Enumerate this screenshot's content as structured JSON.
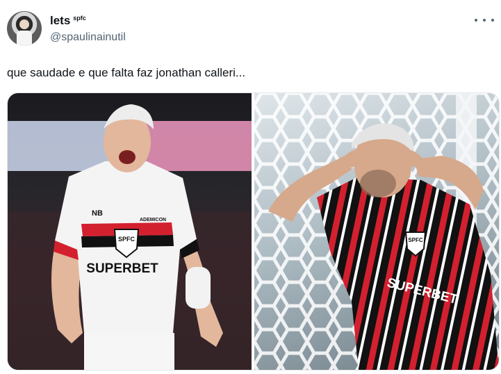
{
  "author": {
    "display_name": "lets",
    "name_badge": "spfc",
    "handle": "@spaulinainutil",
    "avatar_icon": "avatar-photo"
  },
  "more_icon": "more-horizontal-icon",
  "tweet_text": "que saudade e que falta faz jonathan calleri...",
  "media": {
    "left": {
      "shirt_sponsor": "SUPERBET",
      "crest_text": "SPFC",
      "sleeve_brand": "ADEMICON",
      "kit_brand": "NB"
    },
    "right": {
      "shirt_sponsor": "SUPERBET",
      "crest_text": "SPFC"
    }
  },
  "colors": {
    "text_primary": "#0f1419",
    "text_secondary": "#536471",
    "spfc_red": "#d3202f",
    "spfc_black": "#111111"
  }
}
